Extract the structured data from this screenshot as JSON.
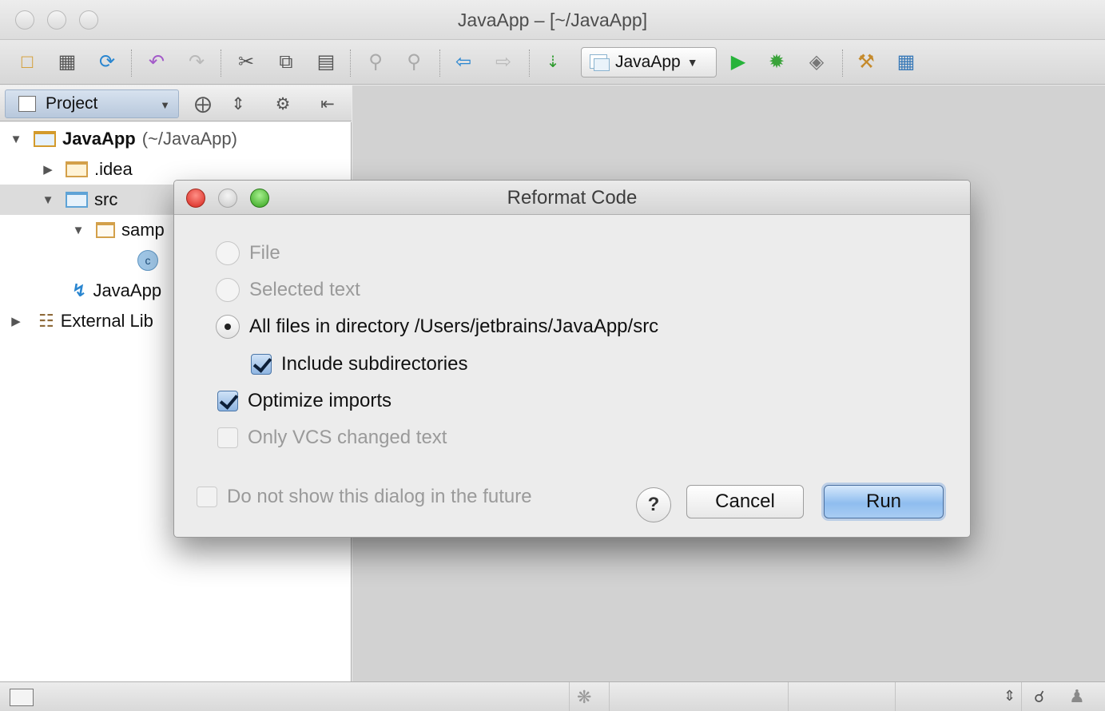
{
  "window": {
    "title": "JavaApp – [~/JavaApp]"
  },
  "toolbar": {
    "run_config": "JavaApp",
    "icons": [
      "folder-icon",
      "save-icon",
      "sync-icon",
      "undo-icon",
      "redo-icon",
      "cut-icon",
      "copy-icon",
      "paste-icon",
      "find-icon",
      "replace-icon",
      "back-icon",
      "forward-icon",
      "make-icon",
      "run-icon",
      "debug-icon",
      "coverage-icon",
      "settings-icon",
      "structure-icon"
    ]
  },
  "project_panel": {
    "view_label": "Project",
    "tree": [
      {
        "label": "JavaApp",
        "suffix": "(~/JavaApp)"
      },
      {
        "label": ".idea"
      },
      {
        "label": "src"
      },
      {
        "label": "samp"
      },
      {
        "label": "JavaApp"
      },
      {
        "label": "External Lib"
      }
    ]
  },
  "dialog": {
    "title": "Reformat Code",
    "options": {
      "file": "File",
      "selected_text": "Selected text",
      "all_files": "All files in directory /Users/jetbrains/JavaApp/src",
      "include_subdirs": "Include subdirectories",
      "optimize_imports": "Optimize imports",
      "only_vcs": "Only VCS changed text",
      "do_not_show": "Do not show this dialog in the future"
    },
    "help_label": "?",
    "cancel_label": "Cancel",
    "run_label": "Run"
  }
}
